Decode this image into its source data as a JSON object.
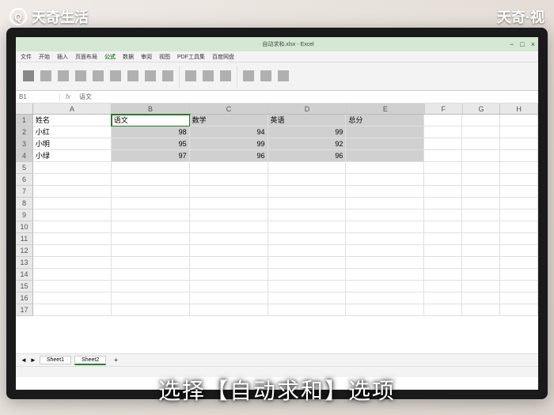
{
  "watermark": {
    "left": "天奇生活",
    "right": "天奇·视"
  },
  "titlebar": {
    "center_title": "自动求和.xlsx - Excel"
  },
  "menubar": {
    "items": [
      "文件",
      "开始",
      "插入",
      "页面布局",
      "公式",
      "数据",
      "审阅",
      "视图",
      "PDF工具集",
      "百度网盘"
    ]
  },
  "formula": {
    "name_box": "B1",
    "fx_label": "fx",
    "input": "语文"
  },
  "columns": [
    "A",
    "B",
    "C",
    "D",
    "E",
    "F",
    "G",
    "H"
  ],
  "chart_data": {
    "type": "table",
    "title": "",
    "headers": {
      "name": "姓名",
      "chinese": "语文",
      "math": "数学",
      "english": "英语",
      "total": "总分"
    },
    "rows": [
      {
        "name": "小红",
        "chinese": 98,
        "math": 94,
        "english": 99
      },
      {
        "name": "小明",
        "chinese": 95,
        "math": 99,
        "english": 92
      },
      {
        "name": "小绿",
        "chinese": 97,
        "math": 96,
        "english": 96
      }
    ]
  },
  "sheet_tabs": {
    "tab1": "Sheet1",
    "tab2": "Sheet2",
    "add": "+"
  },
  "subtitle": "选择【自动求和】选项"
}
